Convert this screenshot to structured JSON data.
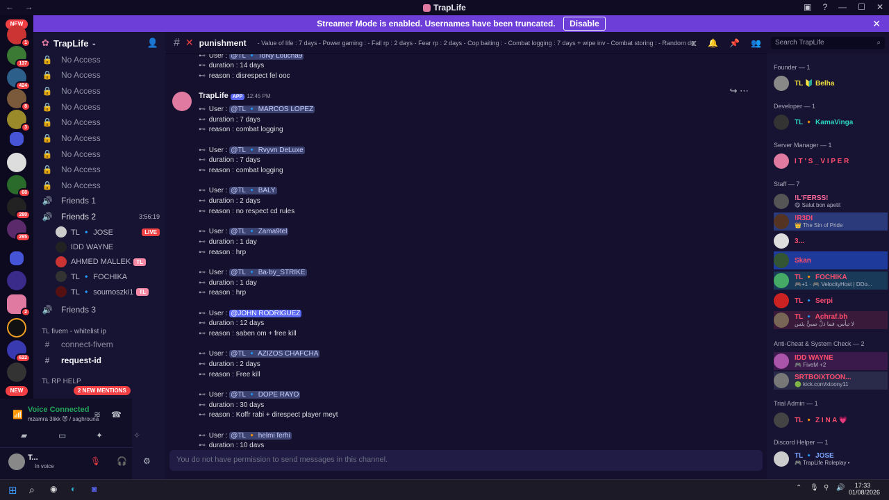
{
  "window": {
    "title": "TrapLife"
  },
  "banner": {
    "text": "Streamer Mode is enabled. Usernames have been truncated.",
    "button": "Disable"
  },
  "guild_badges": {
    "new_top": "NEW",
    "b1": "1",
    "b2": "137",
    "b3": "424",
    "b4": "8",
    "b5": "3",
    "b6": "68",
    "b7": "280",
    "b8": "295",
    "b9": "2",
    "b10": "622",
    "new_bottom": "NEW"
  },
  "server": {
    "name": "TrapLife"
  },
  "channels": {
    "no_access": "No Access",
    "friends1": "Friends 1",
    "friends2": "Friends 2",
    "friends2_timer": "3:56:19",
    "friends3": "Friends 3",
    "category_fivem": "TL fivem - whitelist ip",
    "connect_fivem": "connect-fivem",
    "request_id": "request-id",
    "category_rp": "TL RP HELP",
    "new_mentions": "2 NEW MENTIONS"
  },
  "voice_users": [
    {
      "name": "TL 🔹 JOSE",
      "tag": "LIVE"
    },
    {
      "name": "IDD WAYNE",
      "tag": ""
    },
    {
      "name": "AHMED MALLEK",
      "tag": "TL"
    },
    {
      "name": "TL 🔹 FOCHIKA",
      "tag": ""
    },
    {
      "name": "TL 🔹 soumoszki1",
      "tag": "TL"
    }
  ],
  "voice": {
    "status": "Voice Connected",
    "detail": "mzamra 3likk 😈 / saghrouna"
  },
  "user": {
    "name": "T...",
    "status": "In voice"
  },
  "chat": {
    "channel": "punishment",
    "topic": "- Value of life : 7 days - Power gaming : - Fail rp : 2 days - Fear rp : 2 days - Cop baiting : - Combat logging : 7 days + wipe inv - Combat storing : - Random dea...",
    "search_placeholder": "Search TrapLife",
    "author": "TrapLife",
    "app_tag": "APP",
    "time": "12:45 PM",
    "composer": "You do not have permission to send messages in this channel."
  },
  "top_partial": {
    "user": "@TL 🔹 ToNy Loucha9",
    "duration": "14 days",
    "reason": "disrespect fel ooc"
  },
  "entries": [
    {
      "user": "@TL 🔹 MARCOS LOPEZ",
      "duration": "7 days",
      "reason": "combat logging"
    },
    {
      "user": "@TL 🔹 Rvyvn DeLuxe",
      "duration": "7 days",
      "reason": "combat logging"
    },
    {
      "user": "@TL 🔹 BALY",
      "duration": "2  days",
      "reason": "no respect cd rules"
    },
    {
      "user": "@TL 🔹 Zama9tel",
      "duration": "1 day",
      "reason": "hrp"
    },
    {
      "user": "@TL 🔹 Ba·by_STRIKE",
      "duration": "1 day",
      "reason": "hrp"
    },
    {
      "user": "@JOHN RODRIGUEZ",
      "duration": "12 days",
      "reason": "saben om + free kill"
    },
    {
      "user": "@TL 🔹 AZIZOS CHAFCHA",
      "duration": "2 days",
      "reason": "Free kill"
    },
    {
      "user": "@TL 🔹 DOPE RAYO",
      "duration": "30 days",
      "reason": "Koffr rabi + direspect player meyt"
    },
    {
      "user": "@TL 🔸 helmi ferhi",
      "duration": "10 days",
      "reason": ""
    }
  ],
  "labels": {
    "user": "User :",
    "duration": "duration :",
    "reason": "reason :"
  },
  "members": {
    "founder": {
      "role": "Founder — 1",
      "name": "TL 🔰 Belha"
    },
    "developer": {
      "role": "Developer — 1",
      "name": "TL 🔸 KamaVinga"
    },
    "server_manager": {
      "role": "Server Manager — 1",
      "name": "I T ' S _ V I P E R"
    },
    "staff": {
      "role": "Staff — 7",
      "items": [
        {
          "name": "!L'FERSS!",
          "sub": "😋 Salut bon apetit"
        },
        {
          "name": "!R3DI",
          "sub": "👑 The Sin of Pride"
        },
        {
          "name": "3...",
          "sub": ""
        },
        {
          "name": "Skan",
          "sub": ""
        },
        {
          "name": "TL 🔸 FOCHIKA",
          "sub": "🎮+1 · 🎮 VelocityHost | DDo..."
        },
        {
          "name": "TL 🔹 Serpi",
          "sub": ""
        },
        {
          "name": "TL 🔹 Achraf.bh",
          "sub": "لا تيأس، فما ذلَّ صبيٌّ يئس"
        }
      ]
    },
    "anticheat": {
      "role": "Anti-Cheat & System Check — 2",
      "items": [
        {
          "name": "IDD WAYNE",
          "sub": "🎮 FiveM +2"
        },
        {
          "name": "SRTBOIXTOON...",
          "sub": "🟢 kick.com/xtoony11"
        }
      ]
    },
    "trial": {
      "role": "Trial Admin — 1",
      "name": "TL 🔸 Z I N A 💗"
    },
    "helper": {
      "role": "Discord Helper — 1",
      "name": "TL 🔹 JOSE",
      "sub": "🎮 TrapLife Roleplay •"
    }
  },
  "taskbar": {
    "time": "17:33",
    "date": "01/08/2026"
  }
}
